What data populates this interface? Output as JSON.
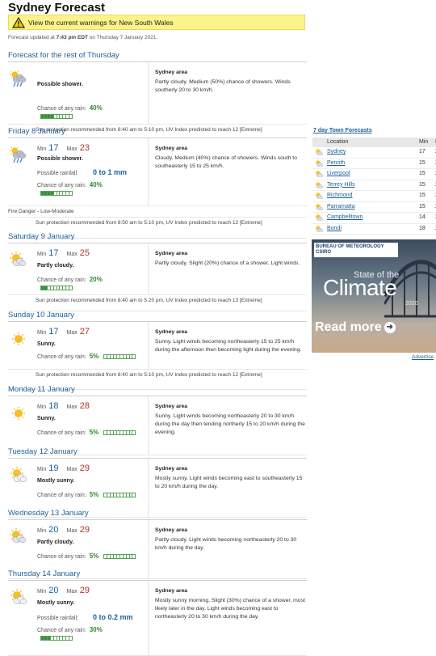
{
  "title": "Sydney Forecast",
  "warning": "View the current warnings for New South Wales",
  "updated": {
    "prefix": "Forecast updated at ",
    "time": "7:43 pm EDT",
    "suffix": " on Thursday 7 January 2021."
  },
  "labels": {
    "min": "Min",
    "max": "Max",
    "chance_rain": "Chance of any rain:",
    "possible_rainfall": "Possible rainfall:",
    "area": "Sydney area"
  },
  "days": [
    {
      "heading": "Forecast for the rest of Thursday",
      "icon": "shower-icon",
      "summary": "Possible shower.",
      "chance": "40%",
      "chance_fraction": 0.4,
      "text": "Partly cloudy. Medium (50%) chance of showers. Winds southerly 20 to 30 km/h.",
      "sun": "Sun protection recommended from 8:40 am to 5:10 pm, UV Index predicted to reach 12 [Extreme]"
    },
    {
      "heading": "Friday 8 January",
      "icon": "shower-icon",
      "min": "17",
      "max": "23",
      "summary": "Possible shower.",
      "rainfall": "0 to 1 mm",
      "chance": "40%",
      "chance_fraction": 0.4,
      "text": "Cloudy. Medium (40%) chance of showers. Winds south to southeasterly 15 to 25 km/h.",
      "fire": "Fire Danger - Low-Moderate",
      "sun": "Sun protection recommended from 8:50 am to 5:10 pm, UV Index predicted to reach 12 [Extreme]"
    },
    {
      "heading": "Saturday 9 January",
      "icon": "partly-cloudy-icon",
      "min": "17",
      "max": "25",
      "summary": "Partly cloudy.",
      "chance": "20%",
      "chance_fraction": 0.2,
      "text": "Partly cloudy. Slight (20%) chance of a shower. Light winds.",
      "sun": "Sun protection recommended from 8:40 am to 5:20 pm, UV Index predicted to reach 13 [Extreme]"
    },
    {
      "heading": "Sunday 10 January",
      "icon": "sunny-icon",
      "min": "17",
      "max": "27",
      "summary": "Sunny.",
      "chance": "5%",
      "chance_fraction": 0.0,
      "text": "Sunny. Light winds becoming northeasterly 15 to 25 km/h during the afternoon then becoming light during the evening.",
      "sun": "Sun protection recommended from 8:40 am to 5:10 pm, UV Index predicted to reach 12 [Extreme]"
    },
    {
      "heading": "Monday 11 January",
      "icon": "sunny-icon",
      "min": "18",
      "max": "28",
      "summary": "Sunny.",
      "chance": "5%",
      "chance_fraction": 0.0,
      "text": "Sunny. Light winds becoming northeasterly 20 to 30 km/h during the day then tending northerly 15 to 20 km/h during the evening."
    },
    {
      "heading": "Tuesday 12 January",
      "icon": "mostly-sunny-icon",
      "min": "19",
      "max": "29",
      "summary": "Mostly sunny.",
      "chance": "5%",
      "chance_fraction": 0.0,
      "text": "Mostly sunny. Light winds becoming east to southeasterly 15 to 20 km/h during the day."
    },
    {
      "heading": "Wednesday 13 January",
      "icon": "partly-cloudy-icon",
      "min": "20",
      "max": "29",
      "summary": "Partly cloudy.",
      "chance": "5%",
      "chance_fraction": 0.0,
      "text": "Partly cloudy. Light winds becoming northeasterly 20 to 30 km/h during the day."
    },
    {
      "heading": "Thursday 14 January",
      "icon": "mostly-sunny-icon",
      "min": "20",
      "max": "29",
      "summary": "Mostly sunny.",
      "rainfall": "0 to 0.2 mm",
      "chance": "30%",
      "chance_fraction": 0.3,
      "text": "Mostly sunny morning. Slight (30%) chance of a shower, most likely later in the day. Light winds becoming east to northeasterly 20 to 30 km/h during the day."
    }
  ],
  "towns": {
    "title": "7 day Town Forecasts",
    "headers": {
      "location": "Location",
      "min": "Min",
      "max": "M"
    },
    "rows": [
      {
        "name": "Sydney",
        "min": "17",
        "max": "2"
      },
      {
        "name": "Penrith",
        "min": "15",
        "max": "2"
      },
      {
        "name": "Liverpool",
        "min": "15",
        "max": "2"
      },
      {
        "name": "Terrey Hills",
        "min": "15",
        "max": "2"
      },
      {
        "name": "Richmond",
        "min": "15",
        "max": "2"
      },
      {
        "name": "Parramatta",
        "min": "15",
        "max": "2"
      },
      {
        "name": "Campbelltown",
        "min": "14",
        "max": "2"
      },
      {
        "name": "Bondi",
        "min": "18",
        "max": "2"
      }
    ]
  },
  "ad": {
    "brand_line1": "BUREAU OF METEOROLOGY",
    "brand_line2": "CSIRO",
    "state": "State of the",
    "climate": "Climate",
    "year": "2020",
    "read_more": "Read more",
    "advertise": "Advertise"
  },
  "colors": {
    "link": "#1b5f96",
    "min": "#1b5f96",
    "max": "#b0352a",
    "rain": "#2d8a2d",
    "warning_bg": "#fdf38a"
  }
}
